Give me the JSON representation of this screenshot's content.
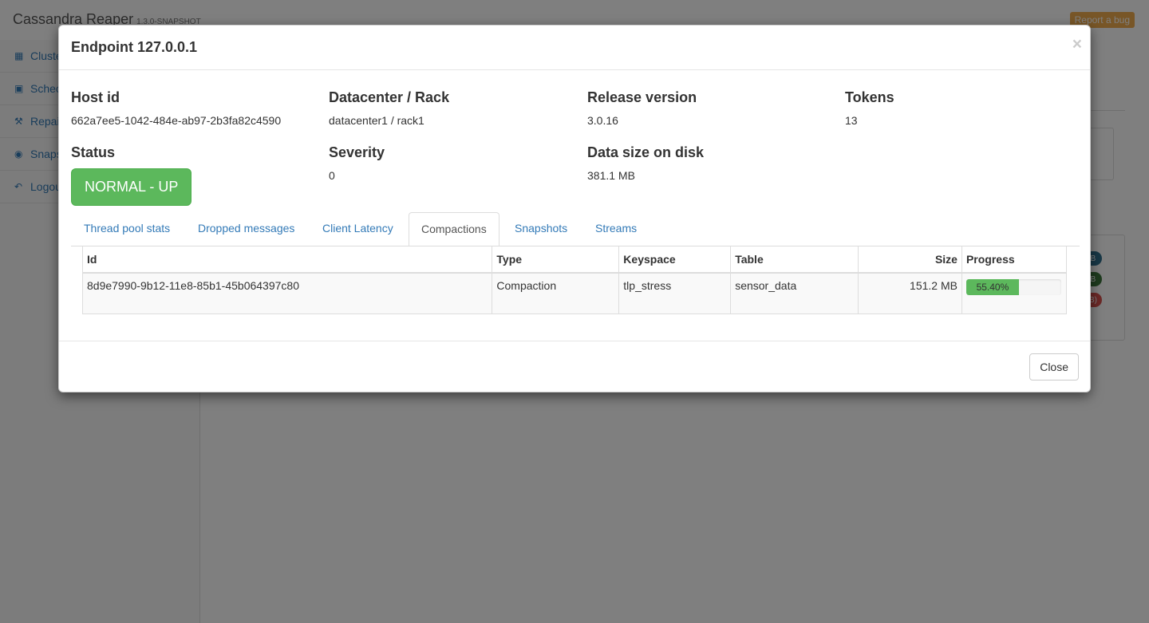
{
  "app": {
    "title": "Cassandra Reaper",
    "version": "1.3.0-SNAPSHOT",
    "report_bug": "Report a bug"
  },
  "sidebar": {
    "items": [
      {
        "label": "Cluste",
        "icon": "sitemap-icon"
      },
      {
        "label": "Schec",
        "icon": "calendar-icon"
      },
      {
        "label": "Repai",
        "icon": "wrench-icon"
      },
      {
        "label": "Snaps",
        "icon": "camera-icon"
      },
      {
        "label": "Logou",
        "icon": "logout-icon"
      }
    ]
  },
  "background_badges": [
    "B",
    "B",
    "B)"
  ],
  "modal": {
    "title": "Endpoint 127.0.0.1",
    "close_symbol": "×",
    "info": {
      "host_id_label": "Host id",
      "host_id": "662a7ee5-1042-484e-ab97-2b3fa82c4590",
      "dc_rack_label": "Datacenter / Rack",
      "dc_rack": "datacenter1 / rack1",
      "release_label": "Release version",
      "release": "3.0.16",
      "tokens_label": "Tokens",
      "tokens": "13",
      "status_label": "Status",
      "status": "NORMAL - UP",
      "severity_label": "Severity",
      "severity": "0",
      "data_size_label": "Data size on disk",
      "data_size": "381.1 MB"
    },
    "tabs": [
      {
        "label": "Thread pool stats",
        "active": false
      },
      {
        "label": "Dropped messages",
        "active": false
      },
      {
        "label": "Client Latency",
        "active": false
      },
      {
        "label": "Compactions",
        "active": true
      },
      {
        "label": "Snapshots",
        "active": false
      },
      {
        "label": "Streams",
        "active": false
      }
    ],
    "table": {
      "headers": [
        "Id",
        "Type",
        "Keyspace",
        "Table",
        "Size",
        "Progress"
      ],
      "rows": [
        {
          "id": "8d9e7990-9b12-11e8-85b1-45b064397c80",
          "type": "Compaction",
          "keyspace": "tlp_stress",
          "table": "sensor_data",
          "size": "151.2 MB",
          "progress_label": "55.40%",
          "progress_fraction": 0.554
        }
      ]
    },
    "close_button": "Close"
  },
  "colors": {
    "success": "#5cb85c",
    "link": "#337ab7",
    "warning": "#f0ad4e",
    "danger": "#d9534f",
    "primary_dark": "#31708f"
  }
}
